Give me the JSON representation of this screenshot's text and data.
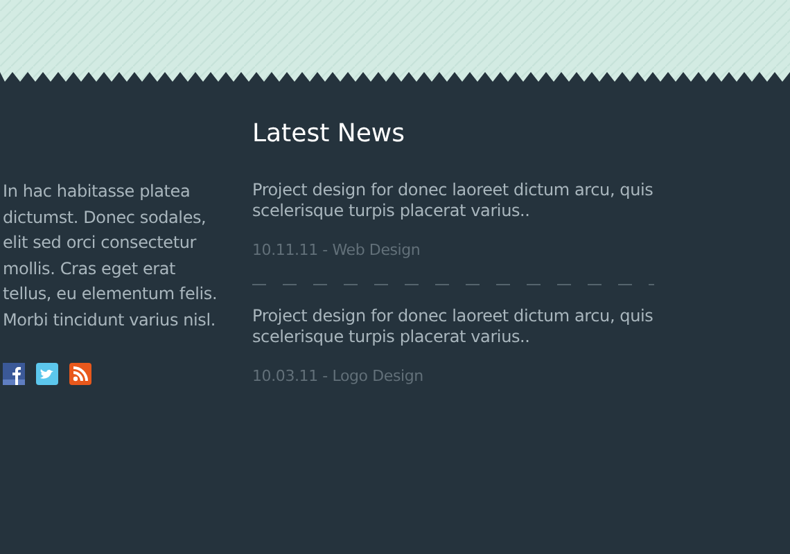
{
  "about": {
    "text": "In hac habitasse platea dictumst. Donec sodales, elit sed orci consectetur mollis. Cras eget erat tellus, eu elementum felis. Morbi tincidunt varius nisl."
  },
  "latest_news": {
    "title": "Latest News",
    "items": [
      {
        "text": "Project design for donec laoreet dictum arcu, quis scelerisque turpis placerat varius..",
        "meta": "10.11.11 - Web Design"
      },
      {
        "text": "Project design for donec laoreet dictum arcu, quis scelerisque turpis placerat varius..",
        "meta": "10.03.11 - Logo Design"
      }
    ]
  }
}
